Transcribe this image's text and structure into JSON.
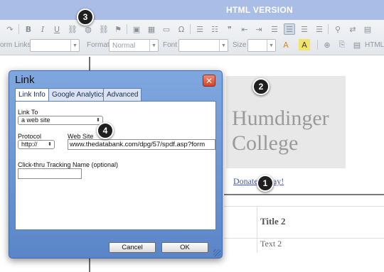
{
  "banner": {
    "title": "HTML VERSION"
  },
  "toolbar": {
    "row1_icons": [
      {
        "name": "redo-icon",
        "glyph": "↷"
      },
      {
        "name": "bold-icon",
        "glyph": "B"
      },
      {
        "name": "italic-icon",
        "glyph": "I"
      },
      {
        "name": "underline-icon",
        "glyph": "U"
      },
      {
        "name": "link-icon",
        "glyph": "⛓"
      },
      {
        "name": "link-world-icon",
        "glyph": "◍"
      },
      {
        "name": "unlink-icon",
        "glyph": "⛓"
      },
      {
        "name": "anchor-flag-icon",
        "glyph": "⚑"
      },
      {
        "name": "image-icon",
        "glyph": "▣"
      },
      {
        "name": "table-icon",
        "glyph": "▦"
      },
      {
        "name": "horizontal-rule-icon",
        "glyph": "▭"
      },
      {
        "name": "special-char-icon",
        "glyph": "Ω"
      },
      {
        "name": "numbered-list-icon",
        "glyph": "☰"
      },
      {
        "name": "bullet-list-icon",
        "glyph": "☷"
      },
      {
        "name": "blockquote-icon",
        "glyph": "❞"
      },
      {
        "name": "outdent-icon",
        "glyph": "⇤"
      },
      {
        "name": "indent-icon",
        "glyph": "⇥"
      },
      {
        "name": "align-left-icon",
        "glyph": "☰"
      },
      {
        "name": "align-center-icon",
        "glyph": "☰"
      },
      {
        "name": "align-right-icon",
        "glyph": "☰"
      },
      {
        "name": "justify-icon",
        "glyph": "☰"
      },
      {
        "name": "find-icon",
        "glyph": "⚲"
      },
      {
        "name": "replace-icon",
        "glyph": "⇄"
      },
      {
        "name": "select-all-icon",
        "glyph": "▤"
      }
    ],
    "row2": {
      "form_links_label": "orm Links",
      "format_label": "Format",
      "format_value": "Normal",
      "font_label": "Font",
      "size_label": "Size",
      "html_label": "HTML"
    }
  },
  "editor": {
    "logo_line1": "Humdinger",
    "logo_line2": "College",
    "donate_link": "Donate Today!",
    "table_title": "Title 2",
    "table_text": "Text 2"
  },
  "dialog": {
    "title": "Link",
    "close_glyph": "✕",
    "tabs": [
      "Link Info",
      "Google Analytics",
      "Advanced"
    ],
    "link_to_label": "Link To",
    "link_to_value": "a web site",
    "protocol_label": "Protocol",
    "protocol_value": "http://",
    "website_label": "Web Site",
    "website_value": "www.thedatabank.com/dpg/57/spdf.asp?form",
    "tracking_label": "Click-thru Tracking Name (optional)",
    "tracking_value": "",
    "cancel_label": "Cancel",
    "ok_label": "OK"
  },
  "badges": [
    "1",
    "2",
    "3",
    "4"
  ]
}
